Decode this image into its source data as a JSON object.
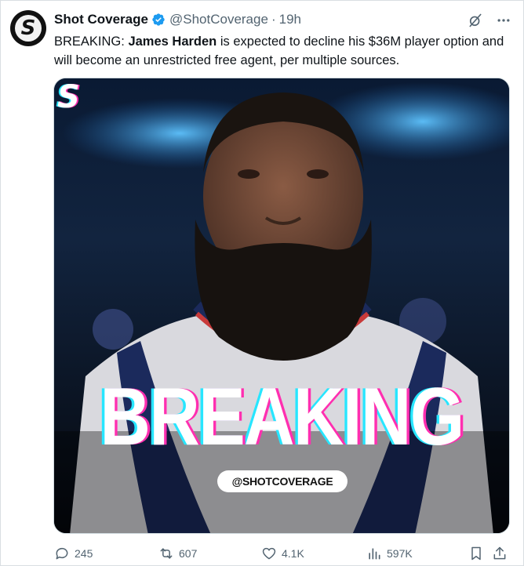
{
  "author": {
    "display_name": "Shot Coverage",
    "handle": "@ShotCoverage",
    "separator": "·",
    "time": "19h",
    "avatar_letter": "S"
  },
  "tweet": {
    "prefix": "BREAKING: ",
    "bold_name": "James Harden",
    "body": " is expected to decline his $36M player option and will become an unrestricted free agent, per multiple sources."
  },
  "media": {
    "corner_logo": "S",
    "headline": "BREAKING",
    "tag": "@SHOTCOVERAGE"
  },
  "actions": {
    "replies": "245",
    "retweets": "607",
    "likes": "4.1K",
    "views": "597K"
  },
  "colors": {
    "verified": "#1d9bf0",
    "muted_text": "#536471",
    "headline_cyan": "#27e6ff",
    "headline_pink": "#ff2fb0"
  },
  "icons": [
    "grok-icon",
    "more-icon",
    "reply-icon",
    "retweet-icon",
    "like-icon",
    "views-icon",
    "bookmark-icon",
    "share-icon",
    "verified-badge-icon"
  ]
}
